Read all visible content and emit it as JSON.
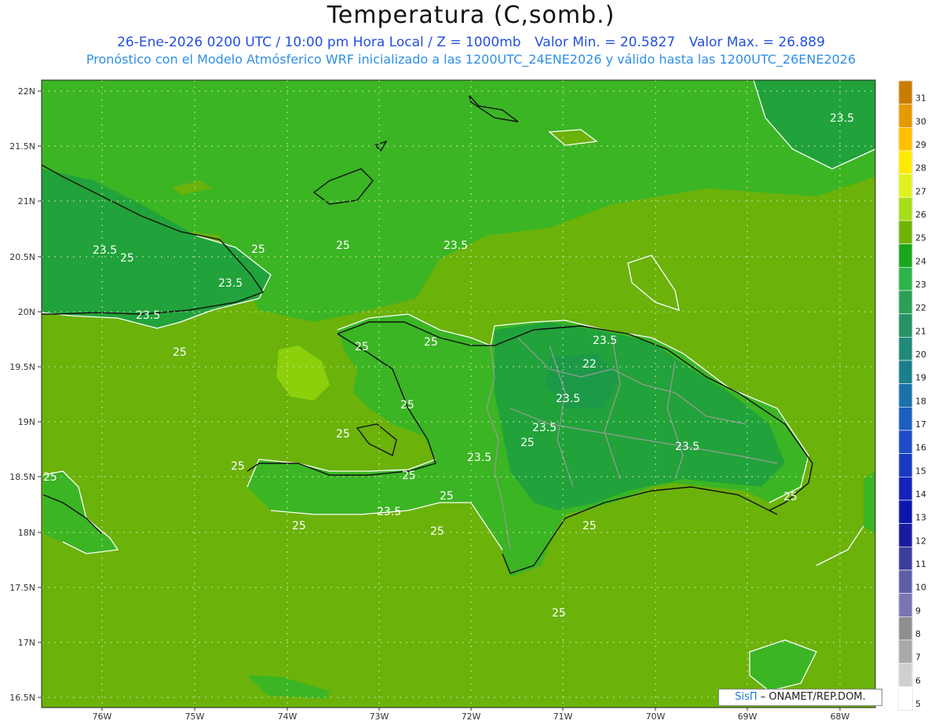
{
  "header": {
    "title": "Temperatura (C,somb.)",
    "date_level": "26-Ene-2026 0200 UTC / 10:00 pm Hora Local / Z = 1000mb",
    "min_value": "Valor Min. = 20.5827",
    "max_value": "Valor Max. = 26.889",
    "model_info": "Pronóstico con el Modelo Atmósferico WRF inicializado a las 1200UTC_24ENE2026 y válido hasta las  1200UTC_26ENE2026"
  },
  "map": {
    "lon_labels": [
      "76W",
      "75W",
      "74W",
      "73W",
      "72W",
      "71W",
      "70W",
      "69W",
      "68W"
    ],
    "lat_labels": [
      "22N",
      "21.5N",
      "21N",
      "20.5N",
      "20N",
      "19.5N",
      "19N",
      "18.5N",
      "18N",
      "17.5N",
      "17N",
      "16.5N"
    ],
    "contour_labels": [
      "23.5",
      "23.5",
      "25",
      "25",
      "25",
      "23.5",
      "23.5",
      "25",
      "23.5",
      "25",
      "25",
      "22",
      "23.5",
      "23.5",
      "23.5",
      "25",
      "23.5",
      "23.5",
      "25",
      "25",
      "25",
      "25",
      "25",
      "25",
      "25",
      "23.5",
      "25",
      "25",
      "25",
      "25"
    ],
    "colors": {
      "ocean": "#6bb20a",
      "land_warm": "#3bb524",
      "land_cool": "#21a23a",
      "hot_spot": "#8ccf0b",
      "border": "#9a9a9a",
      "coast": "#111111"
    }
  },
  "colorbar": {
    "ticks": [
      "31",
      "30",
      "29",
      "28",
      "27",
      "26",
      "25",
      "24",
      "23",
      "22",
      "21",
      "20",
      "19",
      "18",
      "17",
      "16",
      "15",
      "14",
      "13",
      "12",
      "11",
      "10",
      "9",
      "8",
      "7",
      "6",
      "5"
    ],
    "colors": [
      "#c97d00",
      "#e69900",
      "#ffbf00",
      "#ffea00",
      "#e0f220",
      "#a9dc1a",
      "#71b305",
      "#1aa61a",
      "#2cb34a",
      "#2a9f55",
      "#279265",
      "#1f8a78",
      "#1a7f8c",
      "#1b71a8",
      "#1d5fc0",
      "#1c4cc6",
      "#1938c2",
      "#1323b9",
      "#0b16ac",
      "#1a1aa0",
      "#3d3d9f",
      "#5e5ea8",
      "#7a74b3",
      "#8f8f8f",
      "#a9a9a9",
      "#cfcfcf",
      "#ffffff"
    ]
  },
  "footer": {
    "brand": "SisΠ",
    "org": " – ONAMET/REP.DOM."
  }
}
